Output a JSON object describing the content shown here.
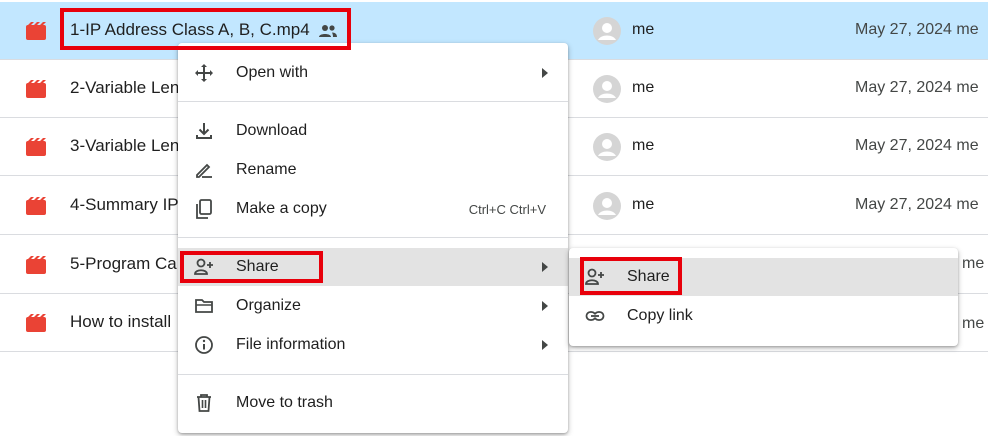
{
  "files": [
    {
      "name": "1-IP Address Class A, B, C.mp4",
      "shared": true,
      "owner": "me",
      "modified": "May 27, 2024",
      "modified_by": "me",
      "selected": true
    },
    {
      "name": "2-Variable Len",
      "shared": false,
      "owner": "me",
      "modified": "May 27, 2024",
      "modified_by": "me",
      "selected": false
    },
    {
      "name": "3-Variable Len",
      "shared": false,
      "owner": "me",
      "modified": "May 27, 2024",
      "modified_by": "me",
      "selected": false
    },
    {
      "name": "4-Summary IP",
      "shared": false,
      "owner": "me",
      "modified": "May 27, 2024",
      "modified_by": "me",
      "selected": false
    },
    {
      "name": "5-Program Ca",
      "shared": false,
      "owner": "",
      "modified": "",
      "modified_by": "me",
      "selected": false
    },
    {
      "name": "How to install",
      "shared": false,
      "owner": "",
      "modified": "",
      "modified_by": "me",
      "selected": false
    }
  ],
  "context_menu": {
    "items": [
      {
        "label": "Open with",
        "icon": "open-with-icon",
        "submenu": true
      },
      {
        "label": "Download",
        "icon": "download-icon"
      },
      {
        "label": "Rename",
        "icon": "rename-icon"
      },
      {
        "label": "Make a copy",
        "icon": "copy-icon",
        "shortcut": "Ctrl+C Ctrl+V"
      },
      {
        "label": "Share",
        "icon": "share-icon",
        "submenu": true
      },
      {
        "label": "Organize",
        "icon": "folder-icon",
        "submenu": true
      },
      {
        "label": "File information",
        "icon": "info-icon",
        "submenu": true
      },
      {
        "label": "Move to trash",
        "icon": "trash-icon"
      }
    ]
  },
  "share_submenu": {
    "items": [
      {
        "label": "Share",
        "icon": "share-person-icon"
      },
      {
        "label": "Copy link",
        "icon": "link-icon"
      }
    ]
  },
  "colors": {
    "selected_row": "#c2e7ff",
    "video_icon": "#ea4335",
    "highlight_box": "#e8000b",
    "hover_item": "#e3e3e3"
  }
}
